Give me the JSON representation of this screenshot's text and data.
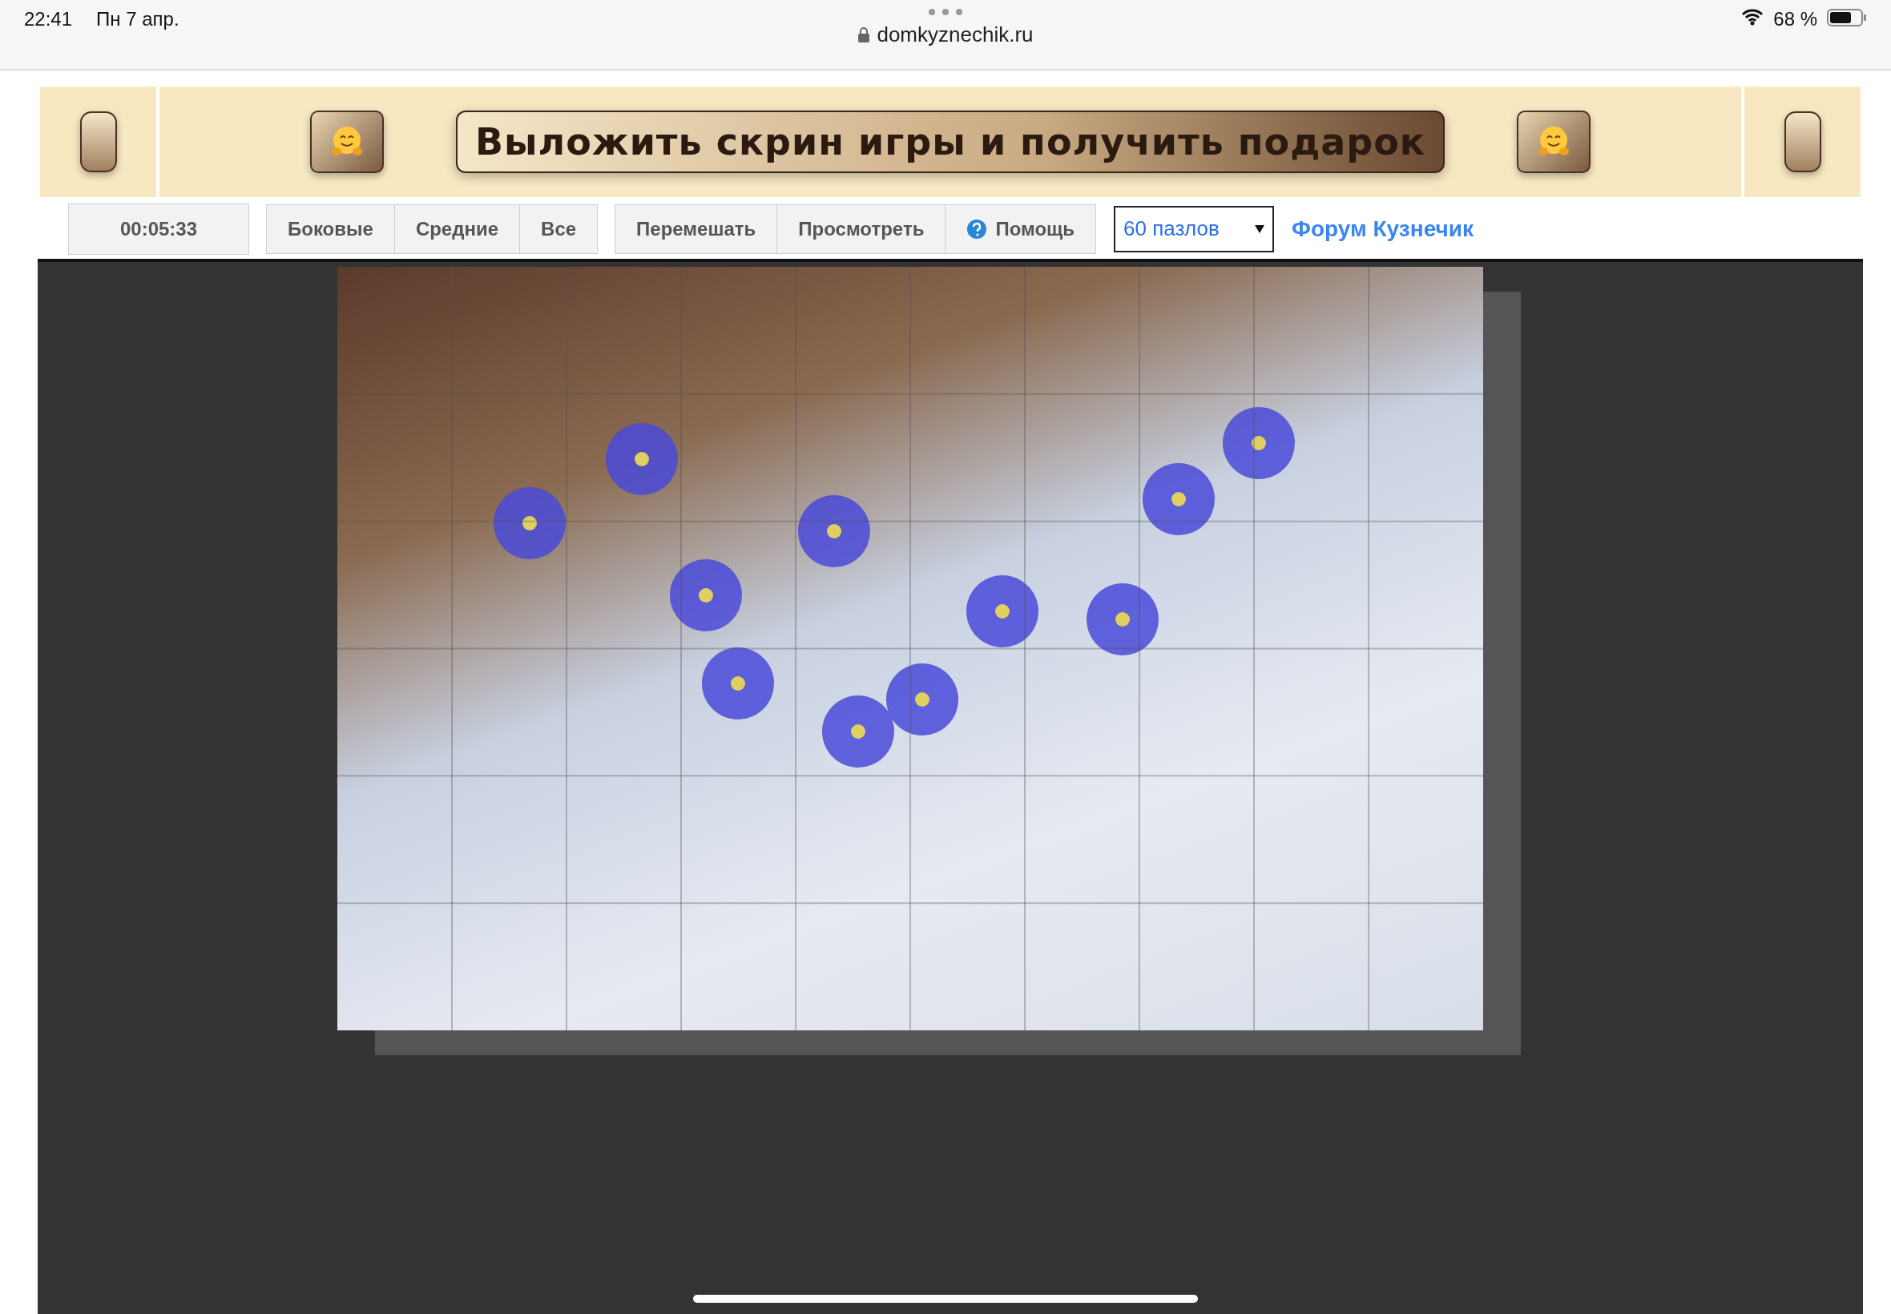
{
  "status_bar": {
    "time": "22:41",
    "date": "Пн 7 апр.",
    "battery": "68 %"
  },
  "address_bar": {
    "url": "domkyznechik.ru"
  },
  "banner": {
    "label": "Выложить скрин игры и получить подарок"
  },
  "toolbar": {
    "timer": "00:05:33",
    "filter_buttons": [
      "Боковые",
      "Средние",
      "Все"
    ],
    "action_buttons": [
      {
        "label": "Перемешать",
        "kind": "plain"
      },
      {
        "label": "Просмотреть",
        "kind": "plain"
      },
      {
        "label": "Помощь",
        "kind": "help"
      }
    ],
    "piece_count": "60 пазлов",
    "forum_link": "Форум Кузнечик"
  }
}
